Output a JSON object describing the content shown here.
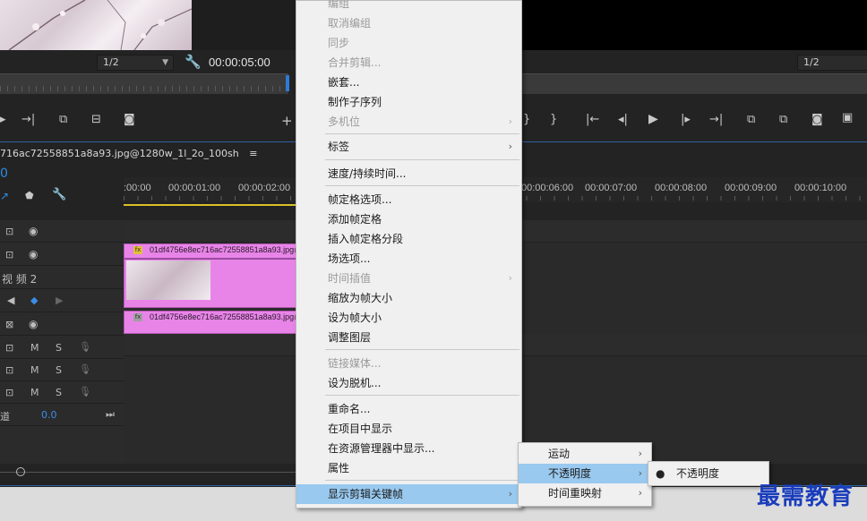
{
  "source_monitor": {
    "resolution": "1/2",
    "timecode": "00:00:05:00"
  },
  "program_monitor": {
    "resolution": "1/2"
  },
  "timeline": {
    "sequence_name": "716ac72558851a8a93.jpg@1280w_1l_2o_100sh",
    "sequence_menu_icon": "≡",
    "playhead_time_fragment": "0",
    "ruler_labels": [
      ":00:00",
      "00:00:01:00",
      "00:00:02:00",
      "00:00:06:00",
      "00:00:07:00",
      "00:00:08:00",
      "00:00:09:00",
      "00:00:10:00"
    ],
    "track_label_v2": "视 频 2",
    "audio_btn_m": "M",
    "audio_btn_s": "S",
    "master_label": "道",
    "master_value": "0.0",
    "clips": [
      {
        "label": "01df4756e8ec716ac72558851a8a93.jpg@",
        "badge": "fx"
      },
      {
        "label": "01df4756e8ec716ac72558851a8a93.jpg@1",
        "badge": "fx"
      }
    ]
  },
  "context_menu": {
    "items": [
      {
        "label": "编组",
        "disabled": true
      },
      {
        "label": "取消编组",
        "disabled": true
      },
      {
        "label": "同步",
        "disabled": true
      },
      {
        "label": "合并剪辑...",
        "disabled": true
      },
      {
        "label": "嵌套...",
        "disabled": false
      },
      {
        "label": "制作子序列",
        "disabled": false
      },
      {
        "label": "多机位",
        "disabled": true
      },
      {
        "label": "标签",
        "disabled": false
      },
      {
        "label": "速度/持续时间...",
        "disabled": false
      },
      {
        "label": "帧定格选项...",
        "disabled": false
      },
      {
        "label": "添加帧定格",
        "disabled": false
      },
      {
        "label": "插入帧定格分段",
        "disabled": false
      },
      {
        "label": "场选项...",
        "disabled": false
      },
      {
        "label": "时间插值",
        "disabled": true
      },
      {
        "label": "缩放为帧大小",
        "disabled": false
      },
      {
        "label": "设为帧大小",
        "disabled": false
      },
      {
        "label": "调整图层",
        "disabled": false
      },
      {
        "label": "链接媒体...",
        "disabled": true
      },
      {
        "label": "设为脱机...",
        "disabled": false
      },
      {
        "label": "重命名...",
        "disabled": false
      },
      {
        "label": "在项目中显示",
        "disabled": false
      },
      {
        "label": "在资源管理器中显示...",
        "disabled": false
      },
      {
        "label": "属性",
        "disabled": false
      },
      {
        "label": "显示剪辑关键帧",
        "disabled": false
      }
    ],
    "submenu_arrow": "›"
  },
  "keyframe_submenu": {
    "items": [
      {
        "label": "运动"
      },
      {
        "label": "不透明度"
      },
      {
        "label": "时间重映射"
      }
    ]
  },
  "opacity_submenu": {
    "items": [
      {
        "label": "不透明度",
        "checked": true
      }
    ],
    "bullet": "●"
  },
  "watermark": "最需教育",
  "colors": {
    "menu_highlight": "#99c9ef",
    "clip_pink": "#e884e8",
    "watermark_blue": "#1a3dbd",
    "accent_blue": "#2e5fa0"
  }
}
